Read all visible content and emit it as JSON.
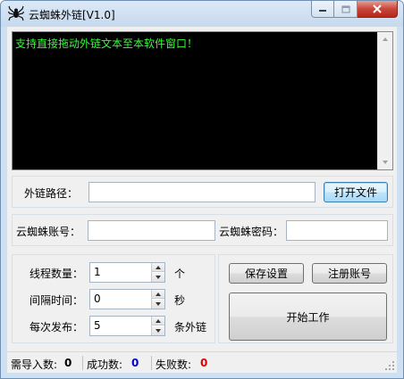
{
  "window": {
    "title": "云蜘蛛外链[V1.0]"
  },
  "log": {
    "text": "支持直接拖动外链文本至本软件窗口！",
    "text_color": "#33ff33",
    "background": "#000000"
  },
  "link_path": {
    "label": "外链路径：",
    "value": "",
    "open_button": "打开文件"
  },
  "account": {
    "user_label": "云蜘蛛账号：",
    "user_value": "",
    "password_label": "云蜘蛛密码：",
    "password_value": ""
  },
  "settings": {
    "threads_label": "线程数量：",
    "threads_value": "1",
    "threads_unit": "个",
    "interval_label": "间隔时间：",
    "interval_value": "0",
    "interval_unit": "秒",
    "per_post_label": "每次发布：",
    "per_post_value": "5",
    "per_post_unit": "条外链"
  },
  "actions": {
    "save_button": "保存设置",
    "register_button": "注册账号",
    "start_button": "开始工作"
  },
  "status": {
    "to_import_label": "需导入数:",
    "to_import_value": "0",
    "success_label": "成功数:",
    "success_value": "0",
    "success_color": "#0000cc",
    "failed_label": "失败数:",
    "failed_value": "0",
    "failed_color": "#e00000"
  }
}
